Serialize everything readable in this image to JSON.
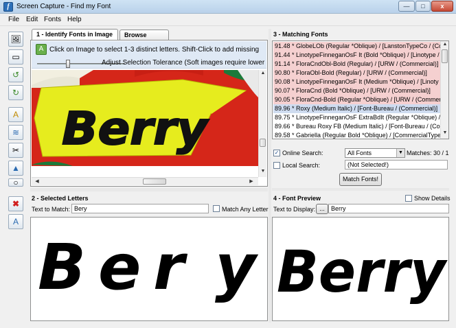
{
  "window": {
    "title": "Screen Capture - Find my Font"
  },
  "window_buttons": {
    "minimize": "—",
    "maximize": "□",
    "close": "x"
  },
  "menu": [
    "File",
    "Edit",
    "Fonts",
    "Help"
  ],
  "toolbar_icons": [
    "capture-image-icon",
    "screen-icon",
    "rotate-left-icon",
    "rotate-right-icon",
    "add-letter-icon",
    "adjust-icon",
    "cut-icon",
    "mountains-icon",
    "zoom-icon",
    "delete-icon",
    "eraser-icon"
  ],
  "panel1": {
    "tabs": [
      "1 - Identify Fonts in Image",
      "Browse Fonts"
    ],
    "hint": "Click on Image to select 1-3 distinct letters. Shift-Click to add missing",
    "tolerance_label": "Adjust Selection Tolerance (Soft images require lower",
    "tolerance_value": 0.4,
    "sample_word": "Berry"
  },
  "panel2": {
    "title": "2 - Selected Letters",
    "text_label": "Text to Match:",
    "text_value": "Bery",
    "match_any_label": "Match Any Letter",
    "match_any_checked": false,
    "preview_letters": [
      "B",
      "e",
      "r",
      "y"
    ]
  },
  "panel3": {
    "title": "3 - Matching Fonts",
    "results": [
      "91.48 * GlobeLOb (Regular *Oblique) / [LanstonTypeCo / (Co",
      "91.44 * LinotypeFinneganOsF It (Bold *Oblique) / [Linotype /",
      "91.14 * FloraCndObl-Bold (Regular) / [URW / (Commercial)]",
      "90.80 * FloraObl-Bold (Regular) / [URW / (Commercial)]",
      "90.08 * LinotypeFinneganOsF It (Medium *Oblique) / [Linoty",
      "90.07 * FloraCnd (Bold *Oblique) / [URW / (Commercial)]",
      "90.05 * FloraCnd-Bold (Regular *Oblique) / [URW / (Commer",
      "89.96 * Roxy (Medium Italic) / [Font-Bureau / (Commercial)]",
      "89.75 * LinotypeFinneganOsF ExtraBdIt (Regular *Oblique) / [",
      "89.66 * Bureau Roxy FB (Medium Italic) / [Font-Bureau / (Co",
      "89.58 * Gabriella (Regular Bold *Oblique) / [CommercialType"
    ],
    "online_label": "Online Search:",
    "online_checked": true,
    "online_select": "All Fonts",
    "matches_label": "Matches: 30 / 1",
    "local_label": "Local Search:",
    "local_checked": false,
    "local_value": "(Not Selected!)",
    "match_button": "Match Fonts!"
  },
  "panel4": {
    "title": "4 - Font Preview",
    "show_details_label": "Show Details",
    "show_details_checked": false,
    "display_label": "Text to Display:",
    "browse_button": "...",
    "display_value": "Berry"
  },
  "colors": {
    "row_red": "#f5d0d0",
    "row_selected": "#cfdcf0",
    "sign_red": "#d52619",
    "sign_yellow": "#e6ec1e"
  }
}
